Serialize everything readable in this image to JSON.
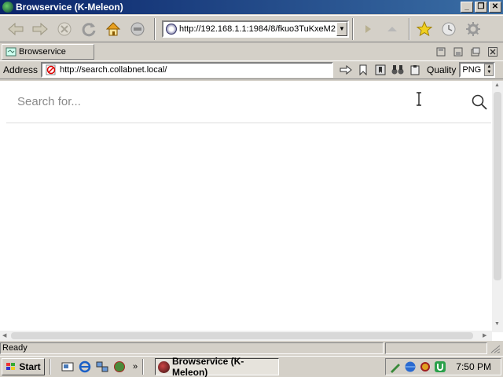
{
  "window": {
    "title": "Browservice (K-Meleon)",
    "controls": {
      "minimize": "_",
      "restore": "❐",
      "close": "✕"
    }
  },
  "toolbar": {
    "buttons": [
      "back-icon",
      "forward-icon",
      "stop-icon",
      "reload-icon",
      "home-icon",
      "print-icon"
    ],
    "url_combo_value": "http://192.168.1.1:1984/8/fkuo3TuKxeM2",
    "extra_buttons": [
      "play-icon",
      "eject-icon",
      "favorites-icon",
      "history-icon",
      "settings-icon"
    ]
  },
  "tabs": [
    {
      "label": "Browservice"
    }
  ],
  "address": {
    "label": "Address",
    "value": "http://search.collabnet.local/",
    "quality_label": "Quality",
    "quality_value": "PNG"
  },
  "page": {
    "search_placeholder": "Search for..."
  },
  "status": {
    "text": "Ready"
  },
  "taskbar": {
    "start_label": "Start",
    "quick_launch": [
      "desktop-icon",
      "ie-icon",
      "network-icon",
      "kmeleon-icon"
    ],
    "task_button_label": "Browservice (K-Meleon)",
    "clock": "7:50 PM"
  },
  "colors": {
    "titlebar_start": "#0a246a",
    "titlebar_end": "#3a6ea5",
    "chrome": "#d4d0c8"
  }
}
